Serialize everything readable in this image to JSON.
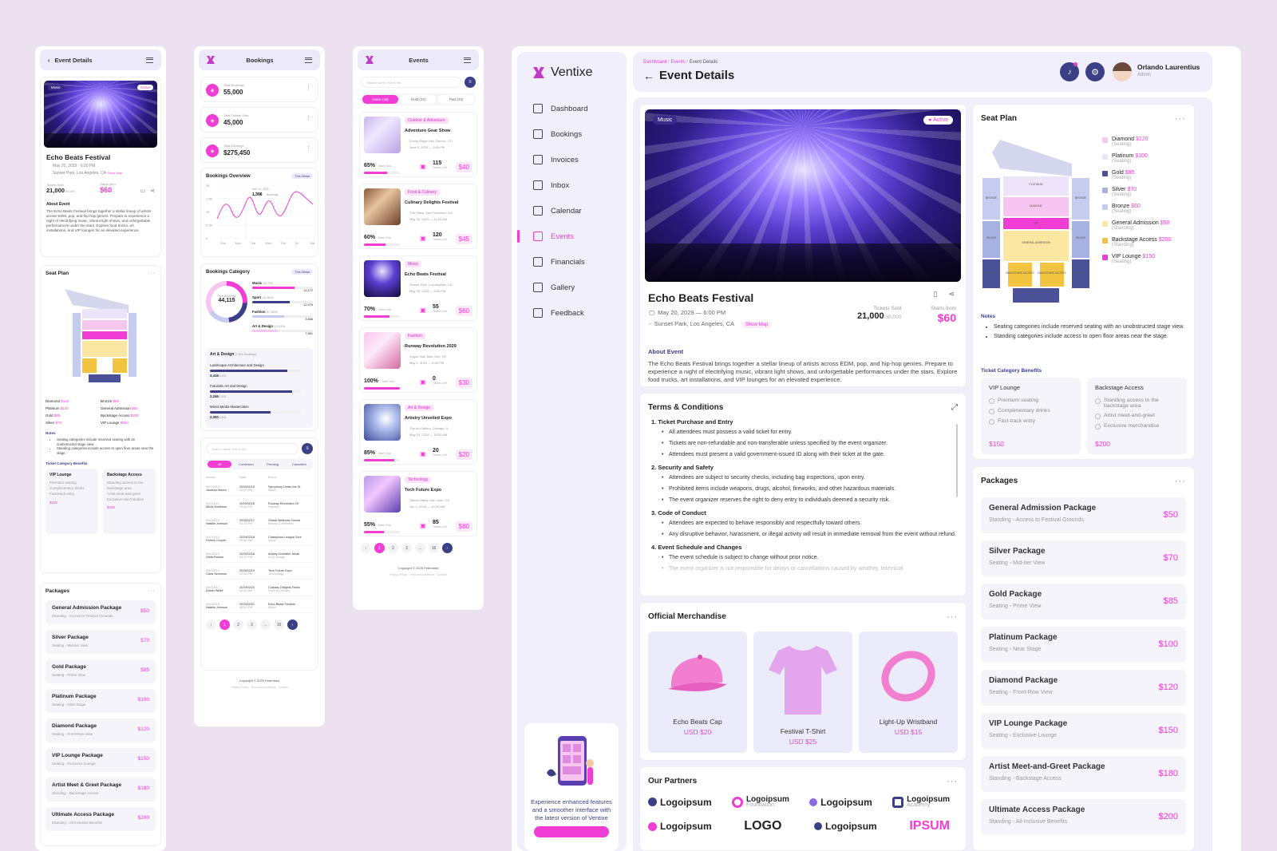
{
  "colors": {
    "accent": "#f03dd4",
    "navy": "#3a3f86",
    "bg": "#ece1ee"
  },
  "main": {
    "brand": "Ventixe",
    "breadcrumb": {
      "a": "Dashboard",
      "b": "Events",
      "c": "Event Details"
    },
    "title": "Event Details",
    "user": {
      "name": "Orlando Laurentius",
      "role": "Admin"
    },
    "nav": [
      "Dashboard",
      "Bookings",
      "Invoices",
      "Inbox",
      "Calendar",
      "Events",
      "Financials",
      "Gallery",
      "Feedback"
    ],
    "nav_icons": [
      "dashboard-icon",
      "bookings-icon",
      "invoices-icon",
      "inbox-icon",
      "calendar-icon",
      "events-icon",
      "financials-icon",
      "gallery-icon",
      "feedback-icon"
    ],
    "promo": {
      "text": "Experience enhanced features and a smoother interface with the latest version of Ventixe"
    },
    "event": {
      "category": "Music",
      "status": "Active",
      "name": "Echo Beats Festival",
      "date": "May 20, 2029 — 6:00 PM",
      "location": "Sunset Park, Los Angeles, CA",
      "show_map": "Show Map",
      "sold_label": "Tickets Sold",
      "sold": "21,000",
      "sold_total": "/30,000",
      "starts_label": "Starts from",
      "price": "$60",
      "about_title": "About Event",
      "about": "The Echo Beats Festival brings together a stellar lineup of artists across EDM, pop, and hip-hop genres. Prepare to experience a night of electrifying music, vibrant light shows, and unforgettable performances under the stars. Explore food trucks, art installations, and VIP lounges for an elevated experience."
    },
    "terms": {
      "title": "Terms & Conditions",
      "sections": [
        {
          "h": "1.   Ticket Purchase and Entry",
          "items": [
            "All attendees must possess a valid ticket for entry.",
            "Tickets are non-refundable and non-transferable unless specified by the event organizer.",
            "Attendees must present a valid government-issued ID along with their ticket at the gate."
          ]
        },
        {
          "h": "2.   Security and Safety",
          "items": [
            "Attendees are subject to security checks, including bag inspections, upon entry.",
            "Prohibited items include weapons, drugs, alcohol, fireworks, and other hazardous materials.",
            "The event organizer reserves the right to deny entry to individuals deemed a security risk."
          ]
        },
        {
          "h": "3.   Code of Conduct",
          "items": [
            "Attendees are expected to behave responsibly and respectfully toward others.",
            "Any disruptive behavior, harassment, or illegal activity will result in immediate removal from the event without refund."
          ]
        },
        {
          "h": "4.   Event Schedule and Changes",
          "items": [
            "The event schedule is subject to change without prior notice.",
            "The event organizer is not responsible for delays or cancellations caused by weather, technical"
          ]
        }
      ]
    },
    "merch": {
      "title": "Official Merchandise",
      "items": [
        {
          "name": "Echo Beats Cap",
          "price": "USD $20"
        },
        {
          "name": "Festival T-Shirt",
          "price": "USD $25"
        },
        {
          "name": "Light-Up Wristband",
          "price": "USD $15"
        }
      ]
    },
    "partners": {
      "title": "Our Partners",
      "row1": [
        "Logoipsum",
        "Logoipsum",
        "Logoipsum",
        "Logoipsum"
      ],
      "row1_sub": [
        "",
        "Foundation",
        "",
        "Academy"
      ],
      "row2": [
        "Logoipsum",
        "LOGO",
        "Logoipsum",
        "IPSUM"
      ]
    },
    "seat": {
      "title": "Seat Plan",
      "legend": [
        {
          "n": "Diamond",
          "p": "$120",
          "s": "(Seating)",
          "c": "#f7c6f0"
        },
        {
          "n": "Platinum",
          "p": "$100",
          "s": "(Seating)",
          "c": "#eee4fa"
        },
        {
          "n": "Gold",
          "p": "$85",
          "s": "(Seating)",
          "c": "#4a5199"
        },
        {
          "n": "Silver",
          "p": "$70",
          "s": "(Seating)",
          "c": "#a7b1e3"
        },
        {
          "n": "Bronze",
          "p": "$60",
          "s": "(Seating)",
          "c": "#c6ccef"
        },
        {
          "n": "General Admission",
          "p": "$50",
          "s": "(Standing)",
          "c": "#fbe6a2"
        },
        {
          "n": "Backstage Access",
          "p": "$200",
          "s": "(Standing)",
          "c": "#f1c33e"
        },
        {
          "n": "VIP Lounge",
          "p": "$150",
          "s": "(Seating)",
          "c": "#f03dd4"
        }
      ],
      "map_labels": [
        "PLATINUM",
        "DIAMOND",
        "VIP",
        "GENERAL ADMISSION",
        "BACKSTAGE ACCESS",
        "STAGE",
        "BRONZE",
        "SILVER",
        "GOLD"
      ],
      "notes_title": "Notes",
      "notes": [
        "Seating categories include reserved seating with an unobstructed stage view.",
        "Standing categories include access to open floor areas near the stage."
      ],
      "benefits_title": "Ticket Category Benefits",
      "benefits": [
        {
          "t": "VIP Lounge",
          "items": [
            "Premium seating",
            "Complimentary drinks",
            "Fast-track entry"
          ],
          "p": "$150"
        },
        {
          "t": "Backstage Access",
          "items": [
            "Standing access to the backstage area",
            "Artist meet-and-greet",
            "Exclusive merchandise"
          ],
          "p": "$200"
        }
      ]
    },
    "packages": {
      "title": "Packages",
      "items": [
        {
          "n": "General Admission Package",
          "a": "Standing",
          "b": "Access to Festival Grounds",
          "p": "$50"
        },
        {
          "n": "Silver Package",
          "a": "Seating",
          "b": "Mid-tier View",
          "p": "$70"
        },
        {
          "n": "Gold Package",
          "a": "Seating",
          "b": "Prime View",
          "p": "$85"
        },
        {
          "n": "Platinum Package",
          "a": "Seating",
          "b": "Near Stage",
          "p": "$100"
        },
        {
          "n": "Diamond Package",
          "a": "Seating",
          "b": "Front-Row View",
          "p": "$120"
        },
        {
          "n": "VIP Lounge Package",
          "a": "Seating",
          "b": "Exclusive Lounge",
          "p": "$150"
        },
        {
          "n": "Artist Meet-and-Greet Package",
          "a": "Standing",
          "b": "Backstage Access",
          "p": "$180"
        },
        {
          "n": "Ultimate Access Package",
          "a": "Standing",
          "b": "All-Inclusive Benefits",
          "p": "$200"
        }
      ]
    }
  },
  "mobile1": {
    "header": "Event Details",
    "category": "Music",
    "status": "Active",
    "name": "Echo Beats Festival",
    "date": "May 20, 2029 · 6:00 PM",
    "location": "Sunset Park, Los Angeles, CA",
    "show_map": "Show Map",
    "sold_label": "Tickets Sold",
    "sold": "21,000",
    "sold_total": "/30,000",
    "starts_label": "Starts from",
    "price": "$60",
    "about_title": "About Event",
    "about": "The Echo Beats Festival brings together a stellar lineup of artists across EDM, pop, and hip-hop genres. Prepare to experience a night of electrifying music, vibrant light shows, and unforgettable performances under the stars. Explore food trucks, art installations, and VIP lounges for an elevated experience.",
    "seat_title": "Seat Plan",
    "legend": [
      [
        "Diamond",
        "$120",
        "Bronze",
        "$60"
      ],
      [
        "Platinum",
        "$100",
        "General Admission",
        "$50"
      ],
      [
        "Gold",
        "$85",
        "Backstage Access",
        "$200"
      ],
      [
        "Silver",
        "$70",
        "VIP Lounge",
        "$150"
      ]
    ],
    "notes_title": "Notes",
    "notes": [
      "Seating categories include reserved seating with an unobstructed stage view.",
      "Standing categories include access to open floor areas near the stage."
    ],
    "benefits_title": "Ticket Category Benefits",
    "packages_title": "Packages",
    "packages": [
      [
        "General Admission Package",
        "Standing",
        "Access to Festival Grounds",
        "$50"
      ],
      [
        "Silver Package",
        "Seating",
        "Mid-tier View",
        "$70"
      ],
      [
        "Gold Package",
        "Seating",
        "Prime View",
        "$85"
      ],
      [
        "Platinum Package",
        "Seating",
        "Near Stage",
        "$100"
      ],
      [
        "Diamond Package",
        "Seating",
        "Front-Row View",
        "$120"
      ],
      [
        "VIP Lounge Package",
        "Seating",
        "Exclusive Lounge",
        "$150"
      ],
      [
        "Artist Meet & Greet Package",
        "Standing",
        "Backstage Access",
        "$180"
      ],
      [
        "Ultimate Access Package",
        "Standing",
        "All-Inclusive Benefits",
        "$200"
      ]
    ]
  },
  "mobile2": {
    "header": "Bookings",
    "stats": [
      {
        "l": "Total Bookings",
        "v": "55,000"
      },
      {
        "l": "Total Tickets Sold",
        "v": "45,000"
      },
      {
        "l": "Total Earnings",
        "v": "$275,450"
      }
    ],
    "overview_title": "Bookings Overview",
    "filter": "This Week",
    "yticks": [
      "2K",
      "1.5K",
      "1K",
      "0.5K",
      "0"
    ],
    "days": [
      "Sun",
      "Mon",
      "Tue",
      "Wed",
      "Thu",
      "Fri",
      "Sat"
    ],
    "tooltip_date": "Mar 13, 2029",
    "tooltip_val": "1,396",
    "tooltip_unit": "Bookings",
    "cat_title": "Bookings Category",
    "total_label": "Total Bookings",
    "total": "44,115",
    "cats": [
      {
        "n": "Music",
        "pct": "(25.7%)",
        "v": "14,172"
      },
      {
        "n": "Sport",
        "pct": "(22.66%)",
        "v": "12,476"
      },
      {
        "n": "Fashion",
        "pct": "(17.83%)",
        "v": "9,806"
      },
      {
        "n": "Art & Design",
        "pct": "(13.93%)",
        "v": "7,661"
      }
    ],
    "art_title": "Art & Design",
    "art_sub": "(7,661 Bookings)",
    "art_items": [
      {
        "n": "Landscape Architecture and Design",
        "v": "3,415",
        "t": "/4,000"
      },
      {
        "n": "Futuristic Art and Design",
        "v": "2,246",
        "t": "/2,500"
      },
      {
        "n": "Mixed Media Masterclass",
        "v": "2,000",
        "t": "/3,000"
      }
    ],
    "search": "Search name, event, etc",
    "tabs": [
      "All",
      "Confirmed",
      "Pending",
      "Cancelled"
    ],
    "cols": [
      "Invoice",
      "Date",
      "Event"
    ],
    "rows": [
      [
        "INV10012",
        "2029/02/15",
        "Symphony Under the St",
        "Jackson Moore",
        "10:00 AM",
        "Music"
      ],
      [
        "INV10012",
        "2029/02/16",
        "Runway Revolution 20",
        "Alicia Smithson",
        "03:45 PM",
        "Fashion"
      ],
      [
        "INV10013",
        "2029/02/17",
        "Global Wellness Summi",
        "Natalie Johnson",
        "01:15 PM",
        "Beauty & Wellness"
      ],
      [
        "INV10014",
        "2029/02/18",
        "Champions League Scre",
        "Patrick Cooper",
        "09:30 AM",
        "Sport"
      ],
      [
        "INV10015",
        "2029/02/18",
        "Artistry Unveiled: Mode",
        "Gilda Ramos",
        "04:00 PM",
        "Art & Design"
      ],
      [
        "INV10016",
        "2029/02/19",
        "Tech Future Expo",
        "Clara Simmons",
        "12:00 PM",
        "Technology"
      ],
      [
        "INV10017",
        "2029/02/20",
        "Culinary Delights Festiv",
        "Daniel White",
        "10:00 AM",
        "Food & Culinary"
      ],
      [
        "INV10018",
        "2029/02/21",
        "Echo Beats Festival",
        "Natalie Johnson",
        "06:00 PM",
        "Music"
      ]
    ],
    "pages": [
      "1",
      "2",
      "3",
      "...",
      "16"
    ],
    "copyright": "Copyright © 2025 Peterdraw",
    "links": [
      "Privacy Policy",
      "Term and conditions",
      "Contact"
    ]
  },
  "mobile3": {
    "header": "Events",
    "search": "Search name, event, etc",
    "tabs": [
      "Active (48)",
      "Draft (22)",
      "Past (32)"
    ],
    "events": [
      {
        "tag": "Outdoor & Adventure",
        "n": "Adventure Gear Show",
        "loc": "Rocky Ridge Hall, Denver, CO",
        "date": "June 5, 2029 — 3:00 PM",
        "pct": "65%",
        "left": "115",
        "price": "$40",
        "fill": 0.65
      },
      {
        "tag": "Food & Culinary",
        "n": "Culinary Delights Festival",
        "loc": "The Plaza, San Francisco, CA",
        "date": "May 25, 2029 — 11:00 AM",
        "pct": "60%",
        "left": "120",
        "price": "$45",
        "fill": 0.6
      },
      {
        "tag": "Music",
        "n": "Echo Beats Festival",
        "loc": "Sunset Park, Los Angeles, CA",
        "date": "May 20, 2029 — 6:00 PM",
        "pct": "70%",
        "left": "55",
        "price": "$60",
        "fill": 0.7
      },
      {
        "tag": "Fashion",
        "n": "Runway Revolution 2029",
        "loc": "Vogue Hall, New York, NY",
        "date": "May 1, 2029 — 6:00 PM",
        "pct": "100%",
        "left": "0",
        "price": "$30",
        "fill": 1
      },
      {
        "tag": "Art & Design",
        "n": "Artistry Unveiled Expo",
        "loc": "The Art Gallery, Chicago, IL",
        "date": "May 15, 2029 — 10:00 AM",
        "pct": "85%",
        "left": "20",
        "price": "$20",
        "fill": 0.85
      },
      {
        "tag": "Technology",
        "n": "Tech Future Expo",
        "loc": "Silicon Valley, San Jose, CA",
        "date": "Jun 1, 2029 — 10:00 AM",
        "pct": "55%",
        "left": "85",
        "price": "$80",
        "fill": 0.55
      }
    ],
    "sold_label": "Ticket Sold",
    "left_label": "Tickets Left",
    "pages": [
      "1",
      "2",
      "3",
      "...",
      "16"
    ],
    "copyright": "Copyright © 2025 Peterdraw",
    "links": [
      "Privacy Policy",
      "Term and conditions",
      "Contact"
    ]
  }
}
